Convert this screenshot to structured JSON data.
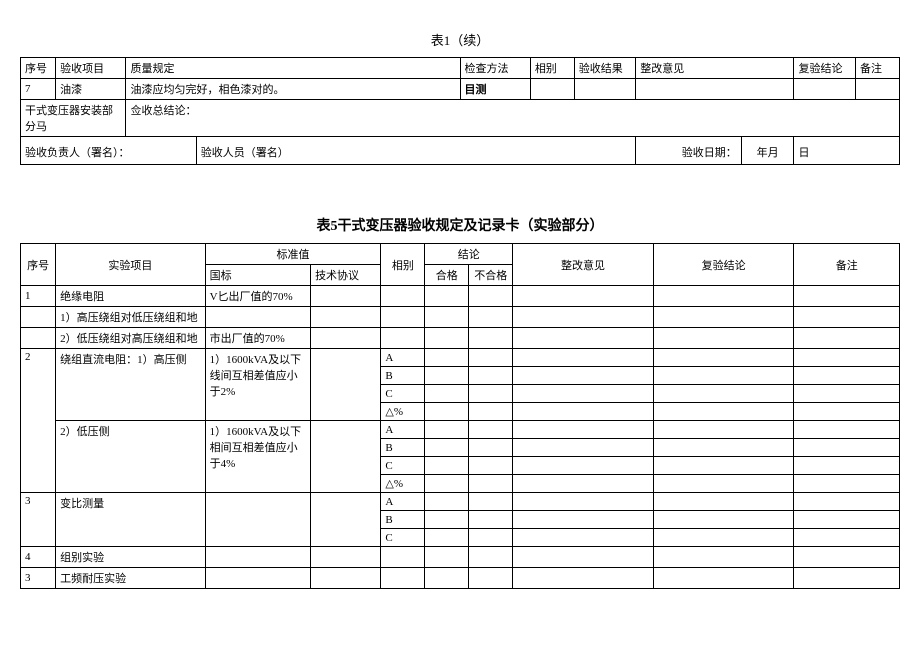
{
  "table1": {
    "caption": "表1（续）",
    "headers": {
      "seq": "序号",
      "item": "验收项目",
      "quality": "质量规定",
      "method": "检查方法",
      "phase": "相别",
      "result": "验收结果",
      "opinion": "整改意见",
      "recheck": "复验结论",
      "remark": "备注"
    },
    "row": {
      "seq": "7",
      "item": "油漆",
      "quality": "油漆应均匀完好，相色漆对的。",
      "method": "目测"
    },
    "summary": {
      "label": "干式变压器安装部分马",
      "conclusion": "佥收总结论："
    },
    "signature": {
      "person1": "验收负责人（署名）：",
      "person2": "验收人员（署名）",
      "date_label": "验收日期：",
      "year_month": "年月",
      "day": "日"
    }
  },
  "table5": {
    "caption": "表5干式变压器验收规定及记录卡（实验部分）",
    "headers": {
      "seq": "序号",
      "item": "实验项目",
      "standard": "标准值",
      "gb": "国标",
      "tech": "技术协议",
      "phase": "相别",
      "conclusion": "结论",
      "pass": "合格",
      "fail": "不合格",
      "opinion": "整改意见",
      "recheck": "复验结论",
      "remark": "备注"
    },
    "rows": {
      "r1": {
        "seq": "1",
        "item_main": "绝缘电阻",
        "item_sub1": "1）高压绕组对低压绕组和地",
        "item_sub2": "2）低压绕组对高压绕组和地",
        "gb1": "V匕出厂值的70%",
        "gb2": "市出厂值的70%"
      },
      "r2": {
        "seq": "2",
        "item_sub1": "绕组直流电阻：1）高压侧",
        "item_sub2": "2）低压侧",
        "gb1": "1）1600kVA及以下线间互相差值应小于2%",
        "gb2": "1）1600kVA及以下相间互相差值应小于4%",
        "phase_a": "A",
        "phase_b": "B",
        "phase_c": "C",
        "delta": "△%"
      },
      "r3": {
        "seq": "3",
        "item": "变比测量",
        "phase_a": "A",
        "phase_b": "B",
        "phase_c": "C"
      },
      "r4": {
        "seq": "4",
        "item": "组别实验"
      },
      "r5": {
        "seq": "3",
        "item": "工频耐压实验"
      }
    }
  }
}
